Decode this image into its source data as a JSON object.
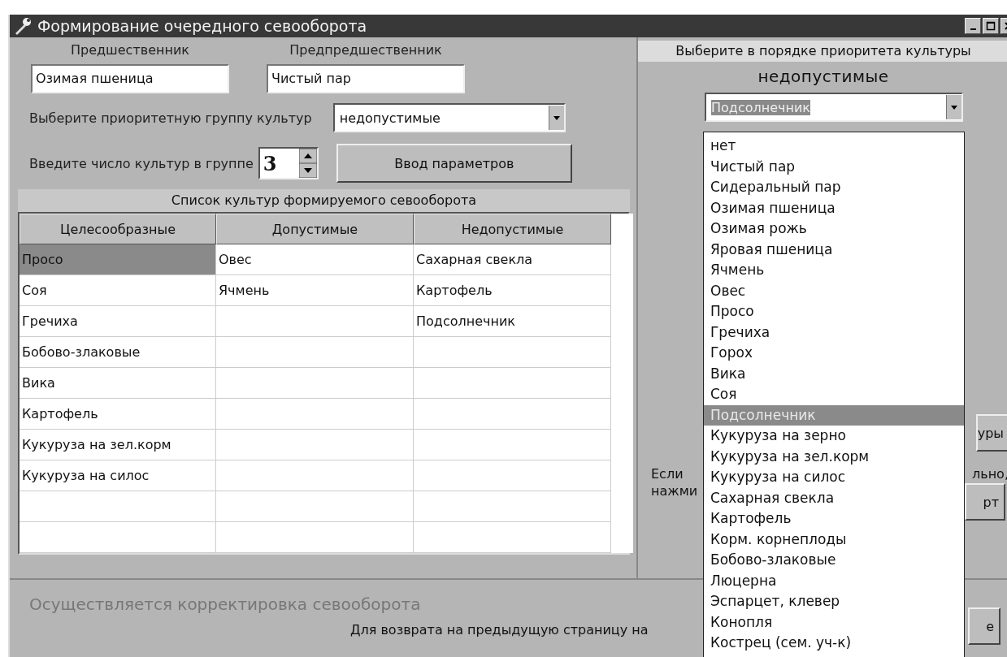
{
  "window": {
    "title": "Формирование очередного севооборота"
  },
  "predecessor": {
    "label": "Предшественник",
    "value": "Озимая пшеница"
  },
  "pre_predecessor": {
    "label": "Предпредшественник",
    "value": "Чистый пар"
  },
  "priority_group": {
    "label": "Выберите приоритетную группу культур",
    "value": "недопустимые"
  },
  "crop_count": {
    "label": "Введите число культур в группе",
    "value": "3"
  },
  "enter_button": "Ввод параметров",
  "table": {
    "caption": "Список культур формируемого севооборота",
    "columns": [
      "Целесообразные",
      "Допустимые",
      "Недопустимые"
    ],
    "rows": [
      {
        "cells": [
          "Просо",
          "Овес",
          "Сахарная свекла"
        ],
        "selected": true
      },
      {
        "cells": [
          "Соя",
          "Ячмень",
          "Картофель"
        ],
        "selected": false
      },
      {
        "cells": [
          "Гречиха",
          null,
          "Подсолнечник"
        ],
        "selected": false
      },
      {
        "cells": [
          "Бобово-злаковые",
          null,
          null
        ],
        "selected": false
      },
      {
        "cells": [
          "Вика",
          null,
          null
        ],
        "selected": false
      },
      {
        "cells": [
          "Картофель",
          null,
          null
        ],
        "selected": false
      },
      {
        "cells": [
          "Кукуруза на зел.корм",
          null,
          null
        ],
        "selected": false
      },
      {
        "cells": [
          "Кукуруза на силос",
          null,
          null
        ],
        "selected": false
      },
      {
        "cells": [
          null,
          null,
          null
        ],
        "selected": false
      },
      {
        "cells": [
          null,
          null,
          null
        ],
        "selected": false
      }
    ]
  },
  "right_panel": {
    "heading": "Выберите в порядке приоритета культуры",
    "group": "недопустимые",
    "combo_value": "Подсолнечник",
    "button_1": "уры",
    "note_start": "Если",
    "note_end": "льно,",
    "note_line_2": "нажми",
    "button_2": "рт"
  },
  "dropdown_list": [
    {
      "label": "нет",
      "selected": false
    },
    {
      "label": "Чистый пар",
      "selected": false
    },
    {
      "label": "Сидеральный пар",
      "selected": false
    },
    {
      "label": "Озимая пшеница",
      "selected": false
    },
    {
      "label": "Озимая рожь",
      "selected": false
    },
    {
      "label": "Яровая пшеница",
      "selected": false
    },
    {
      "label": "Ячмень",
      "selected": false
    },
    {
      "label": "Овес",
      "selected": false
    },
    {
      "label": "Просо",
      "selected": false
    },
    {
      "label": "Гречиха",
      "selected": false
    },
    {
      "label": "Горох",
      "selected": false
    },
    {
      "label": "Вика",
      "selected": false
    },
    {
      "label": "Соя",
      "selected": false
    },
    {
      "label": "Подсолнечник",
      "selected": true
    },
    {
      "label": "Кукуруза на зерно",
      "selected": false
    },
    {
      "label": "Кукуруза на зел.корм",
      "selected": false
    },
    {
      "label": "Кукуруза на силос",
      "selected": false
    },
    {
      "label": "Сахарная свекла",
      "selected": false
    },
    {
      "label": "Картофель",
      "selected": false
    },
    {
      "label": "Корм. корнеплоды",
      "selected": false
    },
    {
      "label": "Бобово-злаковые",
      "selected": false
    },
    {
      "label": "Люцерна",
      "selected": false
    },
    {
      "label": "Эспарцет, клевер",
      "selected": false
    },
    {
      "label": "Конопля",
      "selected": false
    },
    {
      "label": "Кострец (сем. уч-к)",
      "selected": false
    }
  ],
  "status_bar": {
    "message": "Осуществляется корректировка севооборота",
    "hint": "Для возврата на предыдущую страницу на",
    "button": "е"
  }
}
